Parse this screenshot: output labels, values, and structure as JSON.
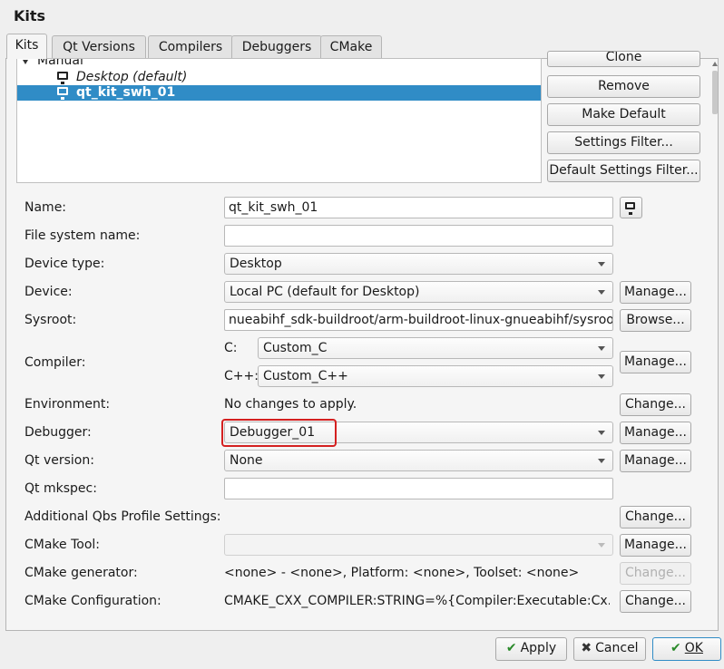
{
  "window": {
    "title": "Kits"
  },
  "tabs": [
    {
      "label": "Kits",
      "active": true
    },
    {
      "label": "Qt Versions",
      "active": false
    },
    {
      "label": "Compilers",
      "active": false
    },
    {
      "label": "Debuggers",
      "active": false
    },
    {
      "label": "CMake",
      "active": false
    }
  ],
  "tree": {
    "group_label": "Manual",
    "items": [
      {
        "label": "Desktop (default)",
        "selected": false,
        "icon": "monitor-icon"
      },
      {
        "label": "qt_kit_swh_01",
        "selected": true,
        "icon": "monitor-icon"
      }
    ]
  },
  "side_buttons": {
    "clone": "Clone",
    "remove": "Remove",
    "make_default": "Make Default",
    "settings_filter": "Settings Filter...",
    "default_settings_filter": "Default Settings Filter..."
  },
  "form": {
    "name": {
      "label": "Name:",
      "value": "qt_kit_swh_01"
    },
    "fs_name": {
      "label": "File system name:",
      "value": ""
    },
    "device_type": {
      "label": "Device type:",
      "value": "Desktop"
    },
    "device": {
      "label": "Device:",
      "value": "Local PC (default for Desktop)",
      "button": "Manage..."
    },
    "sysroot": {
      "label": "Sysroot:",
      "value": "nueabihf_sdk-buildroot/arm-buildroot-linux-gnueabihf/sysroot",
      "button": "Browse..."
    },
    "compiler": {
      "label": "Compiler:",
      "c_label": "C:",
      "c_value": "Custom_C",
      "cpp_label": "C++:",
      "cpp_value": "Custom_C++",
      "button": "Manage..."
    },
    "environment": {
      "label": "Environment:",
      "value": "No changes to apply.",
      "button": "Change..."
    },
    "debugger": {
      "label": "Debugger:",
      "value": "Debugger_01",
      "button": "Manage..."
    },
    "qt_version": {
      "label": "Qt version:",
      "value": "None",
      "button": "Manage..."
    },
    "qt_mkspec": {
      "label": "Qt mkspec:",
      "value": ""
    },
    "qbs": {
      "label": "Additional Qbs Profile Settings:",
      "button": "Change..."
    },
    "cmake_tool": {
      "label": "CMake Tool:",
      "value": "",
      "button": "Manage..."
    },
    "cmake_generator": {
      "label": "CMake generator:",
      "value": "<none> - <none>, Platform: <none>, Toolset: <none>",
      "button": "Change..."
    },
    "cmake_config": {
      "label": "CMake Configuration:",
      "value": "CMAKE_CXX_COMPILER:STRING=%{Compiler:Executable:Cx...",
      "button": "Change..."
    }
  },
  "footer": {
    "apply": "Apply",
    "cancel": "Cancel",
    "ok": "OK"
  },
  "colors": {
    "selection": "#308cc6",
    "highlight_border": "#d42020"
  }
}
